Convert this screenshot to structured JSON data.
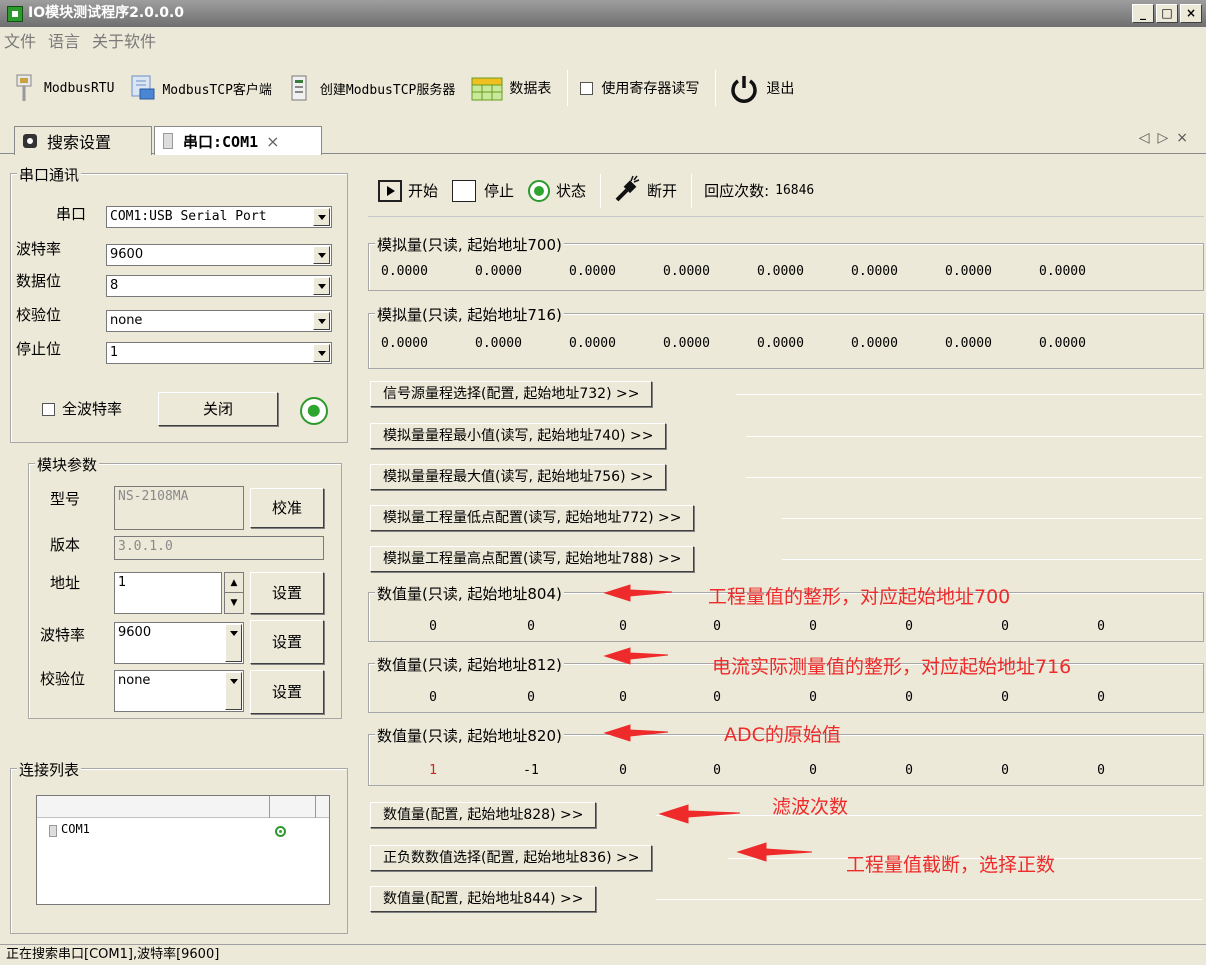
{
  "window": {
    "title": "IO模块测试程序2.0.0.0"
  },
  "menu": [
    "文件",
    "语言",
    "关于软件"
  ],
  "toolbar": {
    "modbus_rtu": "ModbusRTU",
    "modbus_tcp_client": "ModbusTCP客户端",
    "create_server": "创建ModbusTCP服务器",
    "data_table": "数据表",
    "use_register": "使用寄存器读写",
    "exit": "退出"
  },
  "tabs": [
    {
      "label": "搜索设置"
    },
    {
      "label": "串口:COM1"
    }
  ],
  "serial": {
    "legend": "串口通讯",
    "port_label": "串口",
    "port_value": "COM1:USB Serial Port",
    "baud_label": "波特率",
    "baud_value": "9600",
    "data_label": "数据位",
    "data_value": "8",
    "parity_label": "校验位",
    "parity_value": "none",
    "stop_label": "停止位",
    "stop_value": "1",
    "all_baud": "全波特率",
    "close_btn": "关闭"
  },
  "module": {
    "legend": "模块参数",
    "model_label": "型号",
    "model_value": "NS-2108MA",
    "calibrate_btn": "校准",
    "version_label": "版本",
    "version_value": "3.0.1.0",
    "addr_label": "地址",
    "addr_value": "1",
    "set_btn": "设置",
    "baud_label": "波特率",
    "baud_value": "9600",
    "parity_label": "校验位",
    "parity_value": "none"
  },
  "connections": {
    "legend": "连接列表",
    "items": [
      {
        "name": "COM1"
      }
    ]
  },
  "control": {
    "start": "开始",
    "stop": "停止",
    "status": "状态",
    "disconnect": "断开",
    "response_label": "回应次数:",
    "response_count": "16846"
  },
  "analog1": {
    "legend": "模拟量(只读, 起始地址700)",
    "values": [
      "0.0000",
      "0.0000",
      "0.0000",
      "0.0000",
      "0.0000",
      "0.0000",
      "0.0000",
      "0.0000"
    ]
  },
  "analog2": {
    "legend": "模拟量(只读, 起始地址716)",
    "values": [
      "0.0000",
      "0.0000",
      "0.0000",
      "0.0000",
      "0.0000",
      "0.0000",
      "0.0000",
      "0.0000"
    ]
  },
  "expanders": [
    "信号源量程选择(配置, 起始地址732) >>",
    "模拟量量程最小值(读写, 起始地址740) >>",
    "模拟量量程最大值(读写, 起始地址756) >>",
    "模拟量工程量低点配置(读写, 起始地址772) >>",
    "模拟量工程量高点配置(读写, 起始地址788) >>"
  ],
  "digital1": {
    "legend": "数值量(只读, 起始地址804)",
    "values": [
      "0",
      "0",
      "0",
      "0",
      "0",
      "0",
      "0",
      "0"
    ]
  },
  "digital2": {
    "legend": "数值量(只读, 起始地址812)",
    "values": [
      "0",
      "0",
      "0",
      "0",
      "0",
      "0",
      "0",
      "0"
    ]
  },
  "digital3": {
    "legend": "数值量(只读, 起始地址820)",
    "values": [
      "1",
      "-1",
      "0",
      "0",
      "0",
      "0",
      "0",
      "0"
    ]
  },
  "expanders2": [
    "数值量(配置, 起始地址828) >>",
    "正负数数值选择(配置, 起始地址836) >>",
    "数值量(配置, 起始地址844) >>"
  ],
  "annotations": [
    "工程量值的整形，对应起始地址700",
    "电流实际测量值的整形，对应起始地址716",
    "ADC的原始值",
    "滤波次数",
    "工程量值截断，选择正数"
  ],
  "status": "正在搜索串口[COM1],波特率[9600]",
  "colors": {
    "annotation": "#ee2a2a",
    "accent_green": "#2ea52e",
    "highlight_value": "#d42020"
  }
}
